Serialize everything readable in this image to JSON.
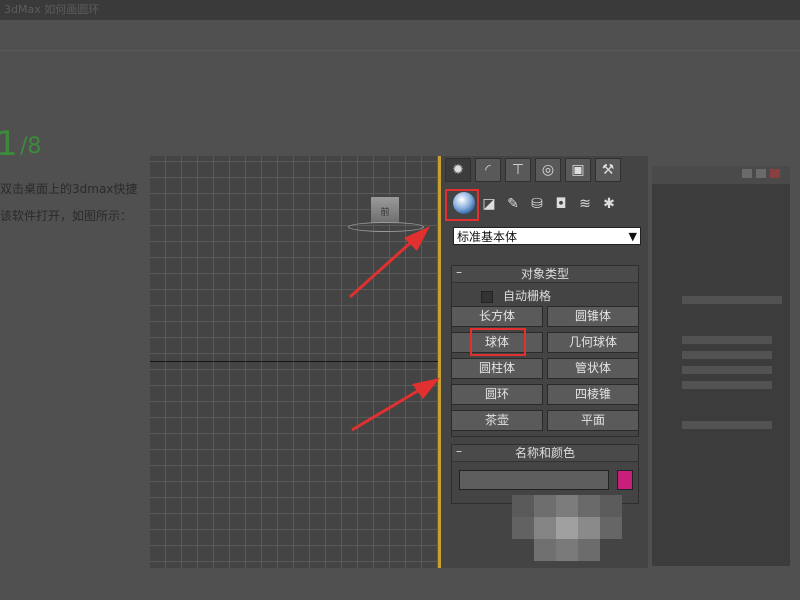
{
  "page": {
    "top_title": "3dMax 如何画圆环",
    "step_number": "1",
    "step_total": "/8",
    "article_lines": [
      "双击桌面上的3dmax快捷",
      "该软件打开，如图所示："
    ]
  },
  "viewport": {
    "viewcube_label": "前"
  },
  "command_panel": {
    "tabs": [
      {
        "icon": "create-star-icon",
        "glyph": "✹"
      },
      {
        "icon": "modify-curve-icon",
        "glyph": "◜"
      },
      {
        "icon": "hierarchy-icon",
        "glyph": "⊤"
      },
      {
        "icon": "motion-icon",
        "glyph": "◎"
      },
      {
        "icon": "display-monitor-icon",
        "glyph": "▣"
      },
      {
        "icon": "utilities-hammer-icon",
        "glyph": "⚒"
      }
    ],
    "subcategory_icons": [
      {
        "icon": "geometry-sphere-icon",
        "glyph": ""
      },
      {
        "icon": "shapes-icon",
        "glyph": "◪"
      },
      {
        "icon": "lights-icon",
        "glyph": "✎"
      },
      {
        "icon": "cameras-icon",
        "glyph": "⛁"
      },
      {
        "icon": "helpers-icon",
        "glyph": "◘"
      },
      {
        "icon": "spacewarps-icon",
        "glyph": "≋"
      },
      {
        "icon": "systems-icon",
        "glyph": "✱"
      }
    ],
    "dropdown_value": "标准基本体",
    "object_type": {
      "title": "对象类型",
      "autogrid_label": "自动栅格",
      "buttons": [
        "长方体",
        "圆锥体",
        "球体",
        "几何球体",
        "圆柱体",
        "管状体",
        "圆环",
        "四棱锥",
        "茶壶",
        "平面"
      ]
    },
    "name_and_color": {
      "title": "名称和颜色",
      "name_value": "",
      "color": "#c8207a"
    }
  },
  "colors": {
    "highlight_red": "#e03030",
    "viewport_active_edge": "#c8a030"
  }
}
